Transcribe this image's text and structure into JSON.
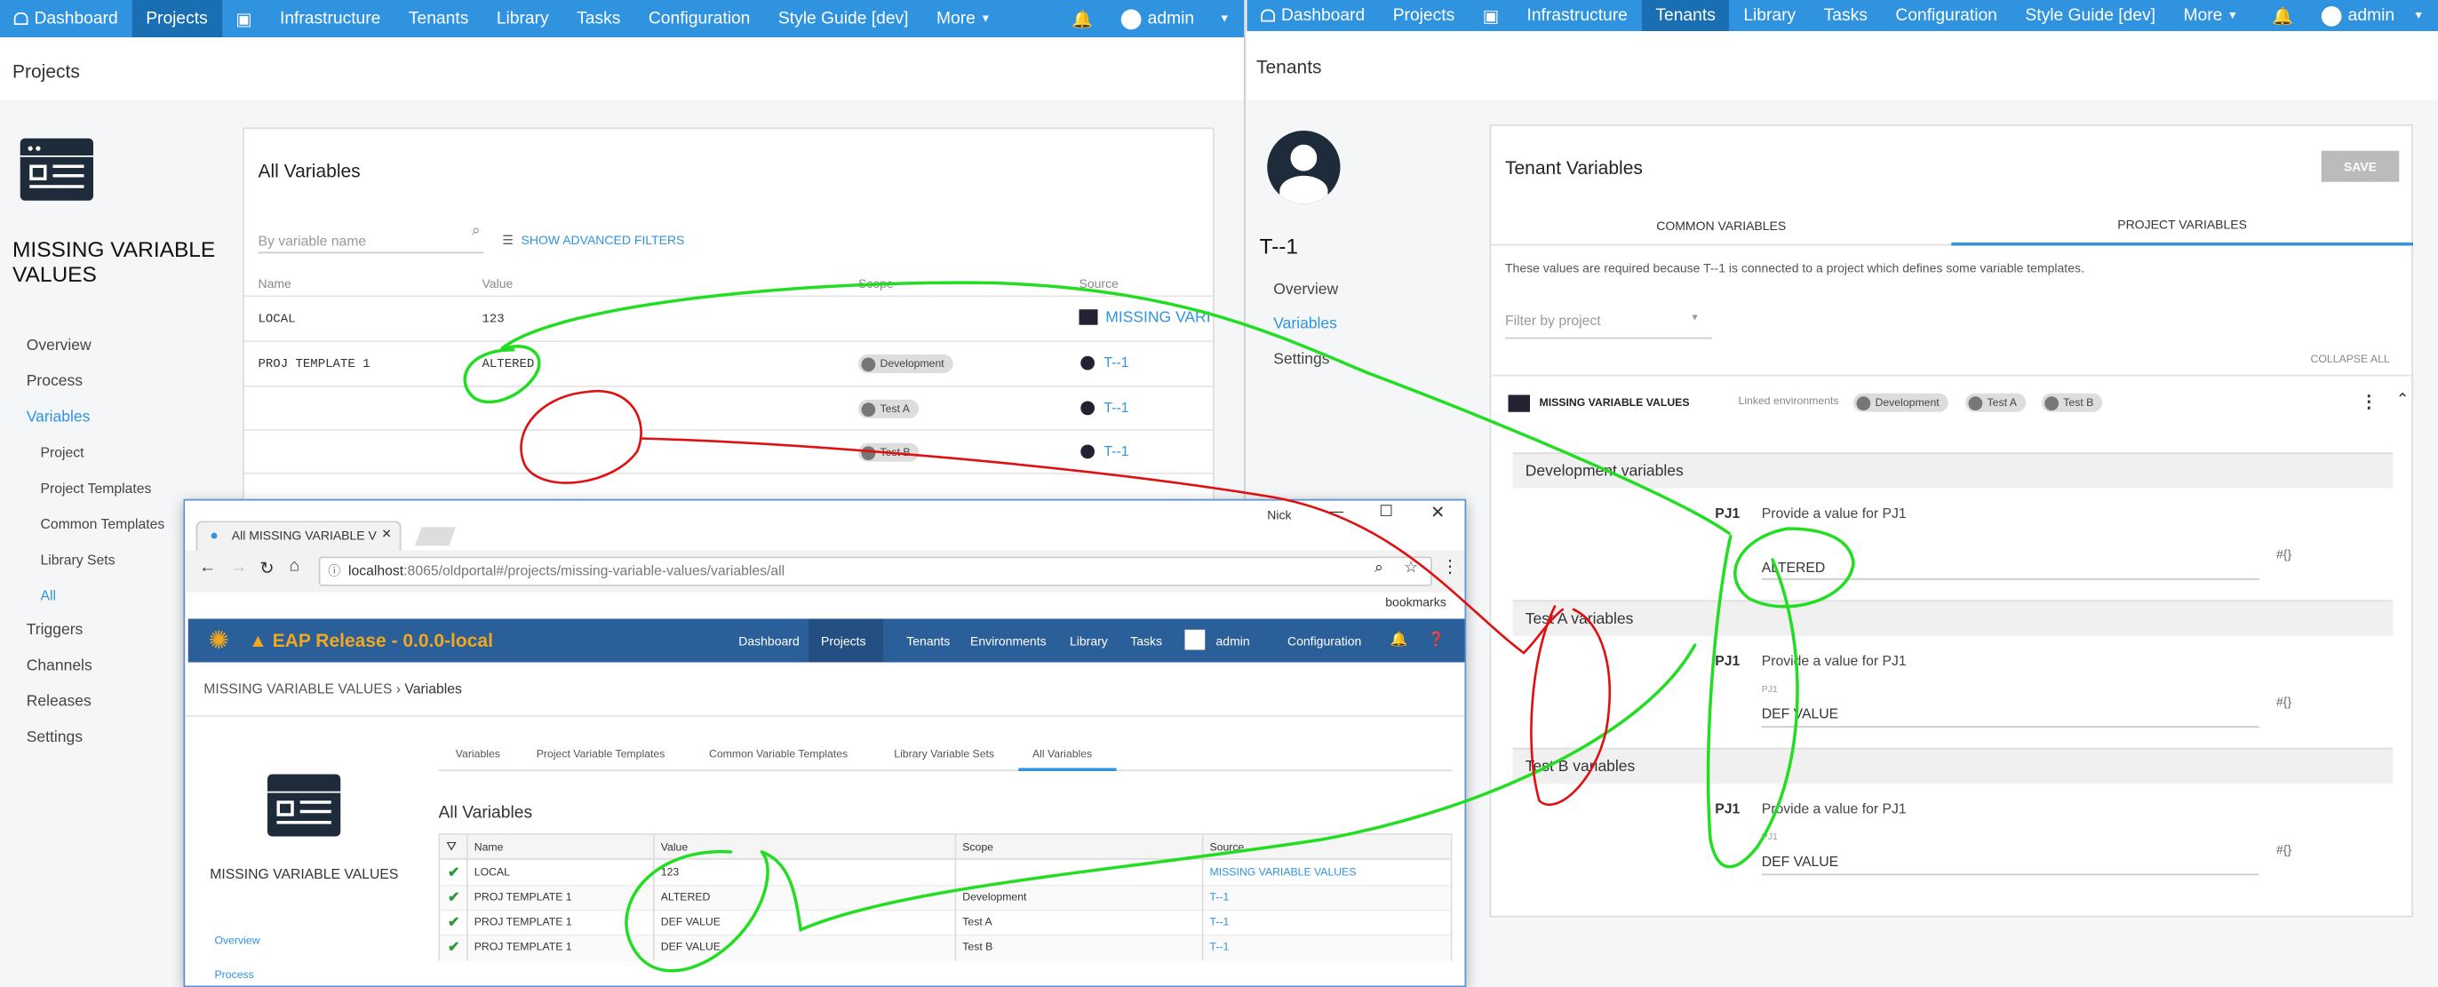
{
  "left": {
    "nav": [
      "Dashboard",
      "Projects",
      "Infrastructure",
      "Tenants",
      "Library",
      "Tasks",
      "Configuration",
      "Style Guide [dev]",
      "More"
    ],
    "user": "admin",
    "breadcrumb": "Projects",
    "project_name": "MISSING VARIABLE VALUES",
    "sidebar": [
      "Overview",
      "Process",
      "Variables",
      "Project",
      "Project Templates",
      "Common Templates",
      "Library Sets",
      "All",
      "Triggers",
      "Channels",
      "Releases",
      "Settings"
    ],
    "card_title": "All Variables",
    "search_placeholder": "By variable name",
    "filters_label": "SHOW ADVANCED FILTERS",
    "columns": [
      "Name",
      "Value",
      "Scope",
      "Source"
    ],
    "rows": [
      {
        "name": "LOCAL",
        "value": "123",
        "scope": "",
        "source": "MISSING VARI"
      },
      {
        "name": "PROJ TEMPLATE 1",
        "value": "ALTERED",
        "scope": "Development",
        "source": "T--1"
      },
      {
        "name": "",
        "value": "",
        "scope": "Test A",
        "source": "T--1"
      },
      {
        "name": "",
        "value": "",
        "scope": "Test B",
        "source": "T--1"
      }
    ]
  },
  "right": {
    "nav": [
      "Dashboard",
      "Projects",
      "Infrastructure",
      "Tenants",
      "Library",
      "Tasks",
      "Configuration",
      "Style Guide [dev]",
      "More"
    ],
    "user": "admin",
    "breadcrumb": "Tenants",
    "tenant_name": "T--1",
    "sidebar": [
      "Overview",
      "Variables",
      "Settings"
    ],
    "card_title": "Tenant Variables",
    "save": "SAVE",
    "tabs": [
      "COMMON VARIABLES",
      "PROJECT VARIABLES"
    ],
    "info": "These values are required because T--1 is connected to a project which defines some variable templates.",
    "filter_placeholder": "Filter by project",
    "collapse": "COLLAPSE ALL",
    "project": "MISSING VARIABLE VALUES",
    "linked_label": "Linked environments",
    "envs": [
      "Development",
      "Test A",
      "Test B"
    ],
    "sections": [
      {
        "title": "Development variables",
        "var": "PJ1",
        "prompt": "Provide a value for PJ1",
        "label": "",
        "value": "ALTERED",
        "hash": "#{}"
      },
      {
        "title": "Test A variables",
        "var": "PJ1",
        "prompt": "Provide a value for PJ1",
        "label": "PJ1",
        "value": "DEF VALUE",
        "hash": "#{}"
      },
      {
        "title": "Test B variables",
        "var": "PJ1",
        "prompt": "Provide a value for PJ1",
        "label": "PJ1",
        "value": "DEF VALUE",
        "hash": "#{}"
      }
    ]
  },
  "browser": {
    "tab_title": "All MISSING VARIABLE V",
    "window_user": "Nick",
    "url_host": "localhost",
    "url_rest": ":8065/oldportal#/projects/missing-variable-values/variables/all",
    "bookmarks": "bookmarks",
    "app_title": "EAP Release - 0.0.0-local",
    "nav": [
      "Dashboard",
      "Projects",
      "Tenants",
      "Environments",
      "Library",
      "Tasks",
      "admin",
      "Configuration"
    ],
    "breadcrumb": [
      "MISSING VARIABLE VALUES",
      "Variables"
    ],
    "project_name": "MISSING VARIABLE VALUES",
    "sidebar": [
      "Overview",
      "Process"
    ],
    "tabs": [
      "Variables",
      "Project Variable Templates",
      "Common Variable Templates",
      "Library Variable Sets",
      "All Variables"
    ],
    "heading": "All Variables",
    "columns": [
      "Name",
      "Value",
      "Scope",
      "Source"
    ],
    "rows": [
      {
        "name": "LOCAL",
        "value": "123",
        "scope": "",
        "source": "MISSING VARIABLE VALUES"
      },
      {
        "name": "PROJ TEMPLATE 1",
        "value": "ALTERED",
        "scope": "Development",
        "source": "T--1"
      },
      {
        "name": "PROJ TEMPLATE 1",
        "value": "DEF VALUE",
        "scope": "Test A",
        "source": "T--1"
      },
      {
        "name": "PROJ TEMPLATE 1",
        "value": "DEF VALUE",
        "scope": "Test B",
        "source": "T--1"
      }
    ]
  },
  "colors": {
    "primary": "#2f93e0",
    "old_header": "#2b5f99",
    "annotation_green": "#22dd22",
    "annotation_red": "#e01010"
  }
}
